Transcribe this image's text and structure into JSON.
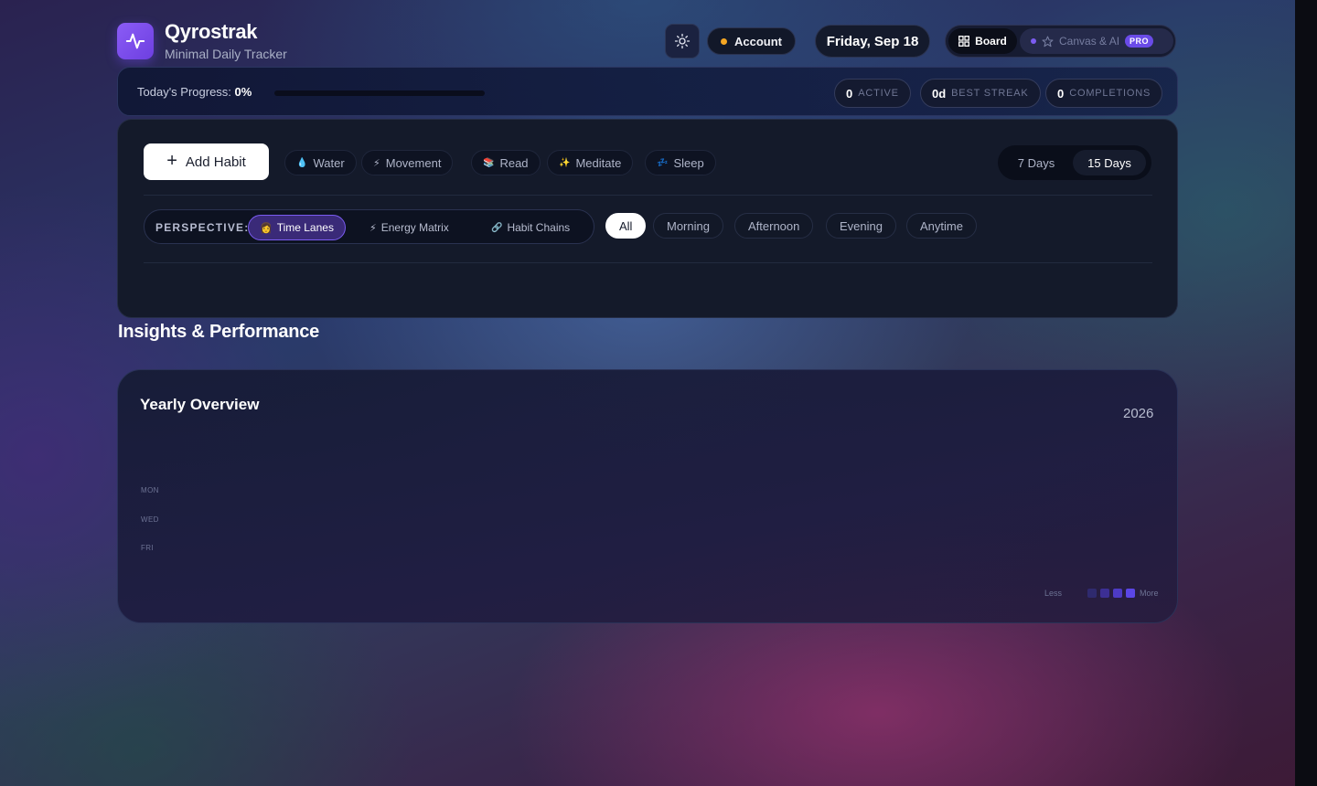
{
  "header": {
    "app_title": "Qyrostrak",
    "app_subtitle": "Minimal Daily Tracker",
    "account_label": "Account",
    "date_label": "Friday, Sep 18",
    "board_label": "Board",
    "canvas_label": "Canvas & AI",
    "pro_badge": "PRO"
  },
  "progress": {
    "label": "Today's Progress:",
    "value_text": "0%",
    "value": 0
  },
  "stats": [
    {
      "value": "0",
      "label": "ACTIVE"
    },
    {
      "value": "0d",
      "label": "BEST STREAK"
    },
    {
      "value": "0",
      "label": "COMPLETIONS"
    }
  ],
  "toolbar": {
    "add_habit_label": "Add Habit",
    "quick_habits": [
      {
        "icon": "💧",
        "label": "Water"
      },
      {
        "icon": "⚡",
        "label": "Movement"
      },
      {
        "icon": "📚",
        "label": "Read"
      },
      {
        "icon": "✨",
        "label": "Meditate"
      },
      {
        "icon": "💤",
        "label": "Sleep"
      }
    ],
    "ranges": [
      "7 Days",
      "15 Days"
    ],
    "selected_range": "15 Days"
  },
  "perspective": {
    "label": "PERSPECTIVE:",
    "tabs": [
      {
        "icon": "👩",
        "label": "Time Lanes"
      },
      {
        "icon": "⚡",
        "label": "Energy Matrix"
      },
      {
        "icon": "🔗",
        "label": "Habit Chains"
      }
    ],
    "selected": "Time Lanes"
  },
  "filters": {
    "items": [
      "All",
      "Morning",
      "Afternoon",
      "Evening",
      "Anytime"
    ],
    "selected": "All"
  },
  "insights": {
    "section_title": "Insights & Performance",
    "yearly_title": "Yearly Overview",
    "year": "2026",
    "day_labels": [
      "MON",
      "WED",
      "FRI"
    ],
    "legend_less": "Less",
    "legend_more": "More",
    "legend_colors": [
      "#2f2a6e",
      "#3c2f94",
      "#4d3bc4",
      "#5b46e6"
    ]
  },
  "colors": {
    "accent": "#7c5cf0",
    "amber_dot": "#f5a623"
  }
}
